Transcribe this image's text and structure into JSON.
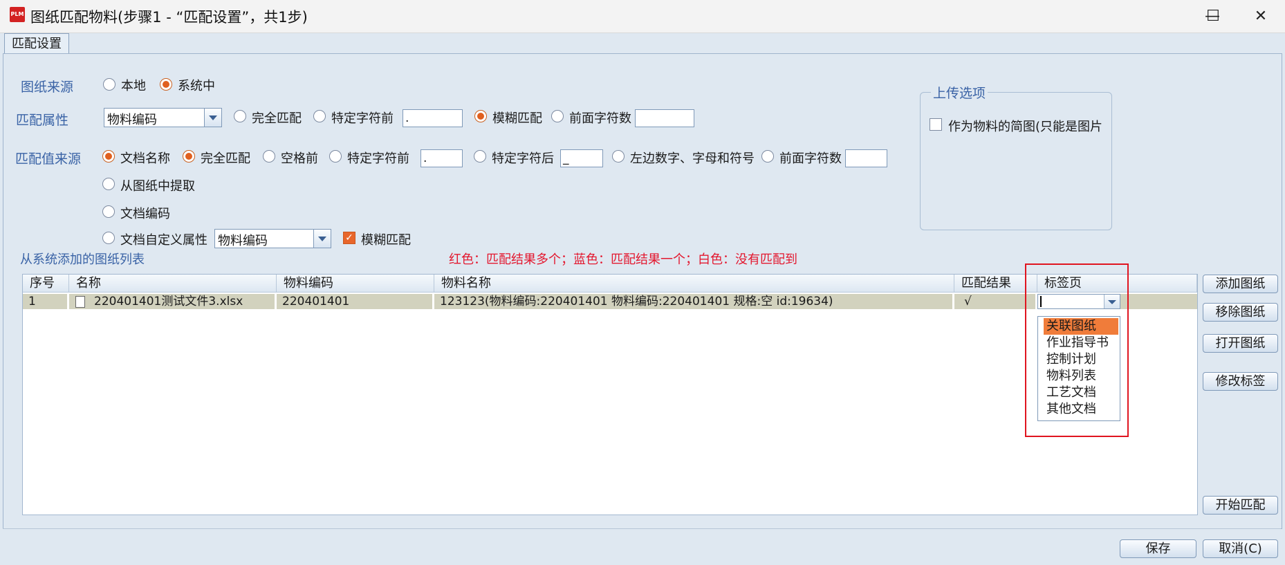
{
  "window": {
    "icon_text": "PLM",
    "title": "图纸匹配物料(步骤1 - “匹配设置”，共1步)",
    "minimize_glyph": "—",
    "maximize_glyph": "☐",
    "close_glyph": "✕"
  },
  "tab": {
    "label": "匹配设置"
  },
  "source": {
    "label": "图纸来源",
    "options": [
      {
        "label": "本地",
        "checked": false
      },
      {
        "label": "系统中",
        "checked": true
      }
    ]
  },
  "match_attr": {
    "label": "匹配属性",
    "combo_value": "物料编码",
    "opt_exact": "完全匹配",
    "opt_prefix_char": "特定字符前",
    "prefix_char_value": ".",
    "opt_fuzzy": "模糊匹配",
    "opt_leading_count": "前面字符数",
    "leading_count_value": ""
  },
  "match_value_source": {
    "label": "匹配值来源",
    "opt_doc_name": "文档名称",
    "opt_exact": "完全匹配",
    "opt_before_space": "空格前",
    "opt_before_char": "特定字符前",
    "before_char_value": ".",
    "opt_after_char": "特定字符后",
    "after_char_value": "_",
    "opt_left_alnum": "左边数字、字母和符号",
    "opt_leading_count": "前面字符数",
    "leading_count_value": "",
    "opt_extract": "从图纸中提取",
    "opt_doc_code": "文档编码",
    "opt_custom_attr": "文档自定义属性",
    "custom_attr_combo": "物料编码",
    "fuzzy_checkbox": "模糊匹配",
    "fuzzy_checked": true
  },
  "upload_options": {
    "title": "上传选项",
    "as_thumbnail": "作为物料的简图(只能是图片",
    "as_thumbnail_checked": false
  },
  "list": {
    "title": "从系统添加的图纸列表",
    "legend": "红色：匹配结果多个；蓝色：匹配结果一个；白色：没有匹配到",
    "columns": [
      "序号",
      "名称",
      "物料编码",
      "物料名称",
      "匹配结果",
      "标签页"
    ],
    "rows": [
      {
        "index": "1",
        "name": "220401401测试文件3.xlsx",
        "material_code": "220401401",
        "material_name": "123123(物料编码:220401401 物料编码:220401401 规格:空 id:19634)",
        "result": "√",
        "tab": ""
      }
    ]
  },
  "tab_dropdown": {
    "options": [
      "关联图纸",
      "作业指导书",
      "控制计划",
      "物料列表",
      "工艺文档",
      "其他文档"
    ],
    "highlighted_index": 0
  },
  "side_buttons": {
    "add": "添加图纸",
    "remove": "移除图纸",
    "open": "打开图纸",
    "edit_tag": "修改标签",
    "start": "开始匹配"
  },
  "footer": {
    "save": "保存",
    "cancel": "取消(C)"
  },
  "colors": {
    "accent": "#3a63a6",
    "radio_on": "#e0601f",
    "legend": "#e3172e",
    "selected_row": "#d2d2be",
    "dropdown_highlight": "#f07c3a"
  }
}
